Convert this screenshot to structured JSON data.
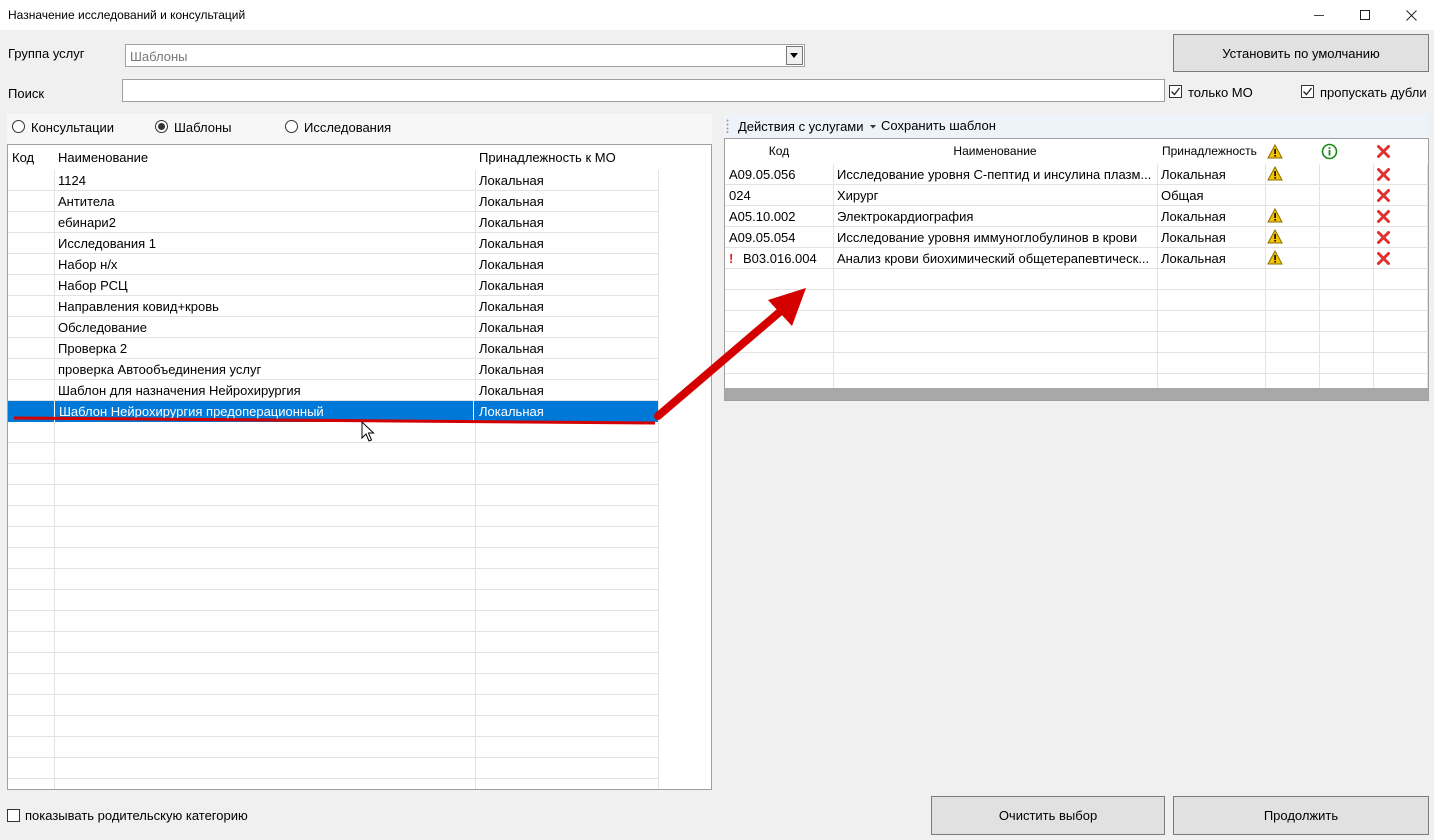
{
  "window": {
    "title": "Назначение исследований и консультаций",
    "controls": [
      "minimize-icon",
      "maximize-icon",
      "close-icon"
    ]
  },
  "filters": {
    "group_label": "Группа услуг",
    "group_value": "Шаблоны",
    "search_label": "Поиск",
    "search_value": "",
    "default_button": "Установить по умолчанию",
    "only_mo_label": "только МО",
    "only_mo_checked": true,
    "skip_dupes_label": "пропускать дубли",
    "skip_dupes_checked": true
  },
  "radios": {
    "consultations": "Консультации",
    "templates": "Шаблоны",
    "studies": "Исследования",
    "selected": "templates"
  },
  "left_grid": {
    "headers": {
      "code": "Код",
      "name": "Наименование",
      "belonging": "Принадлежность к МО"
    },
    "rows": [
      {
        "code": "",
        "name": "1124",
        "belonging": "Локальная"
      },
      {
        "code": "",
        "name": "Антитела",
        "belonging": "Локальная"
      },
      {
        "code": "",
        "name": "ебинари2",
        "belonging": "Локальная"
      },
      {
        "code": "",
        "name": "Исследования 1",
        "belonging": "Локальная"
      },
      {
        "code": "",
        "name": "Набор н/х",
        "belonging": "Локальная"
      },
      {
        "code": "",
        "name": "Набор РСЦ",
        "belonging": "Локальная"
      },
      {
        "code": "",
        "name": "Направления ковид+кровь",
        "belonging": "Локальная"
      },
      {
        "code": "",
        "name": "Обследование",
        "belonging": "Локальная"
      },
      {
        "code": "",
        "name": "Проверка 2",
        "belonging": "Локальная"
      },
      {
        "code": "",
        "name": "проверка Автообъединения услуг",
        "belonging": "Локальная"
      },
      {
        "code": "",
        "name": "Шаблон для назначения Нейрохирургия",
        "belonging": "Локальная"
      },
      {
        "code": "",
        "name": "Шаблон Нейрохирургия предоперационный",
        "belonging": "Локальная",
        "selected": true
      }
    ]
  },
  "toolbar": {
    "actions_label": "Действия с услугами",
    "save_template_label": "Сохранить шаблон"
  },
  "right_grid": {
    "headers": {
      "code": "Код",
      "name": "Наименование",
      "belonging": "Принадлежность"
    },
    "header_icons": [
      "warning-icon",
      "info-icon",
      "delete-icon"
    ],
    "rows": [
      {
        "marker": "",
        "code": "A09.05.056",
        "name": "Исследование уровня С-пептид и инсулина плазм...",
        "belonging": "Локальная",
        "warning": true
      },
      {
        "marker": "",
        "code": "024",
        "name": "Хирург",
        "belonging": "Общая",
        "warning": false
      },
      {
        "marker": "",
        "code": "A05.10.002",
        "name": "Электрокардиография",
        "belonging": "Локальная",
        "warning": true
      },
      {
        "marker": "",
        "code": "A09.05.054",
        "name": "Исследование уровня иммуноглобулинов в крови",
        "belonging": "Локальная",
        "warning": true
      },
      {
        "marker": "!",
        "code": "B03.016.004",
        "name": "Анализ крови биохимический общетерапевтическ...",
        "belonging": "Локальная",
        "warning": true
      }
    ]
  },
  "footer": {
    "show_parent_label": "показывать родительскую категорию",
    "show_parent_checked": false,
    "clear_button": "Очистить выбор",
    "continue_button": "Продолжить"
  },
  "colors": {
    "selection": "#0078d7",
    "annotation_arrow": "#d40000",
    "warning": "#f5c400",
    "info": "#1a8a1a",
    "delete": "#e03030"
  }
}
